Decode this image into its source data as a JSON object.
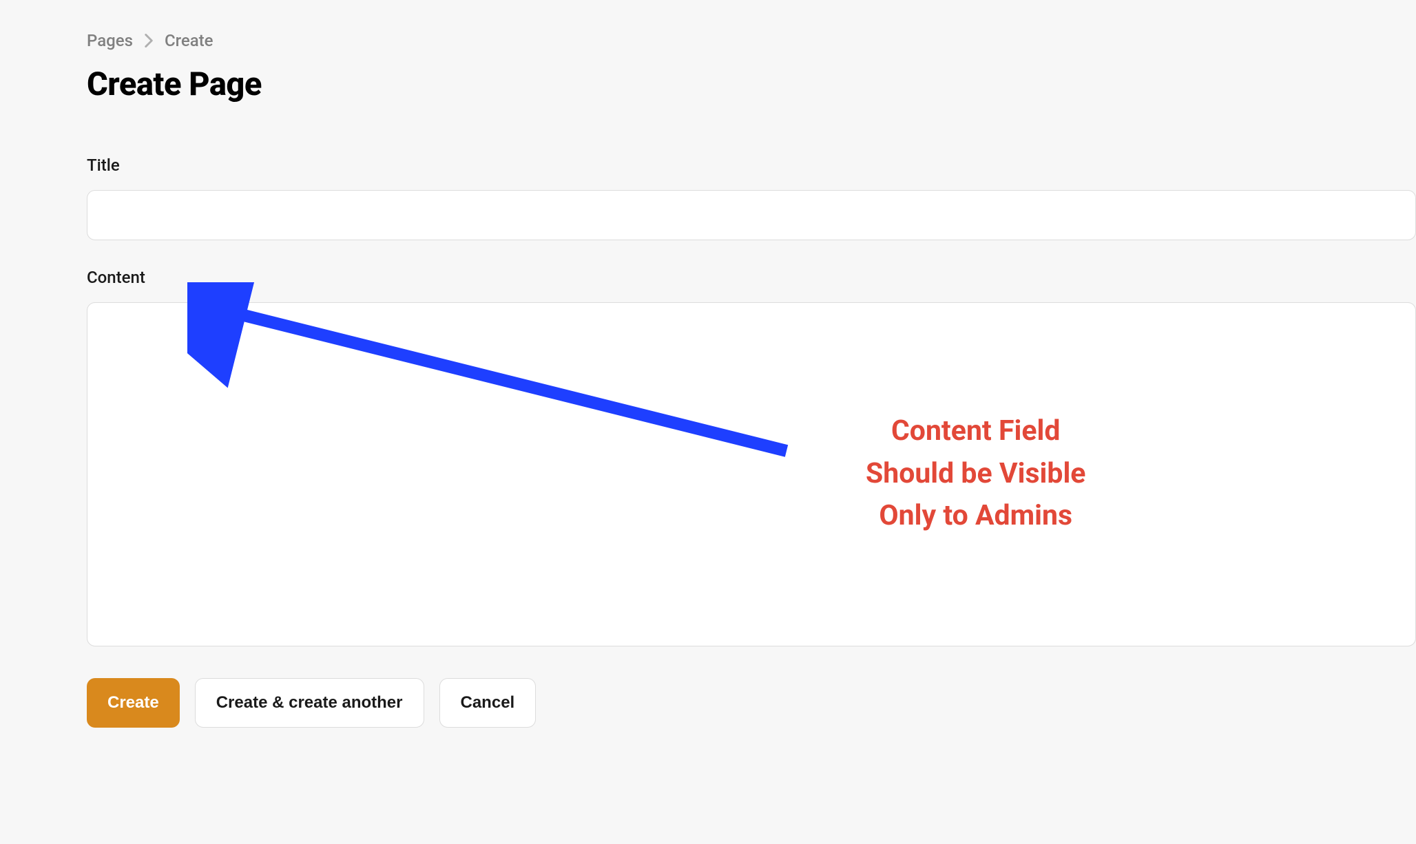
{
  "breadcrumb": {
    "items": [
      {
        "label": "Pages"
      },
      {
        "label": "Create"
      }
    ]
  },
  "page": {
    "title": "Create Page"
  },
  "form": {
    "title": {
      "label": "Title",
      "value": ""
    },
    "content": {
      "label": "Content",
      "value": ""
    }
  },
  "buttons": {
    "create": "Create",
    "create_another": "Create & create another",
    "cancel": "Cancel"
  },
  "annotation": {
    "line1": "Content Field",
    "line2": "Should be Visible",
    "line3": "Only to Admins",
    "arrow_color": "#1e3fff"
  }
}
